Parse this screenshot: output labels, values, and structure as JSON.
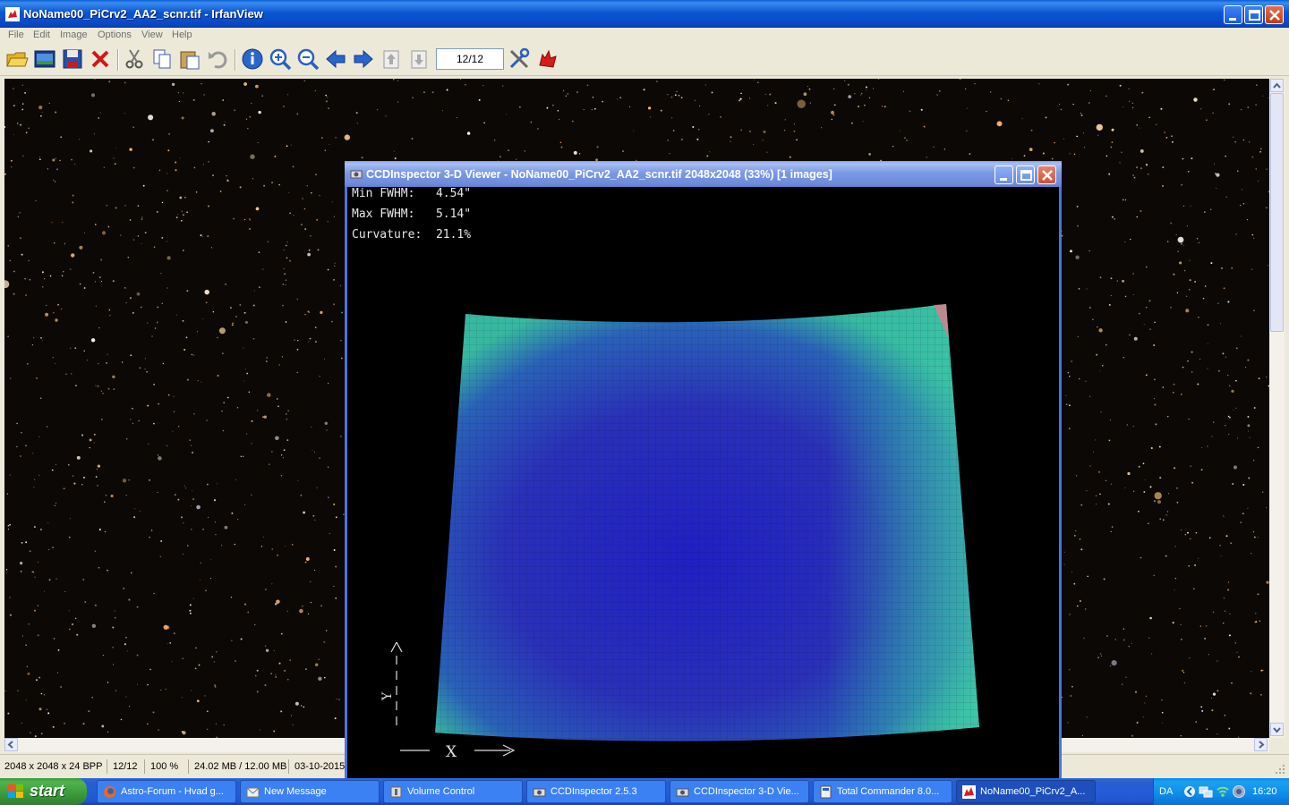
{
  "main_window": {
    "title": "NoName00_PiCrv2_AA2_scnr.tif - IrfanView",
    "menu": [
      "File",
      "Edit",
      "Image",
      "Options",
      "View",
      "Help"
    ],
    "page_counter": "12/12",
    "toolbar_icons": [
      "open-folder-icon",
      "thumbnails-icon",
      "save-icon",
      "delete-icon",
      "cut-icon",
      "copy-icon",
      "paste-icon",
      "undo-icon",
      "info-icon",
      "zoom-in-icon",
      "zoom-out-icon",
      "previous-arrow-icon",
      "next-arrow-icon",
      "first-page-icon",
      "last-page-icon",
      "settings-tools-icon",
      "irfanview-cat-icon"
    ]
  },
  "status_bar": {
    "dimensions": "2048 x 2048 x 24 BPP",
    "index": "12/12",
    "zoom": "100 %",
    "memory": "24.02 MB / 12.00 MB",
    "date": "03-10-2015"
  },
  "viewer": {
    "title": "CCDInspector 3-D Viewer - NoName00_PiCrv2_AA2_scnr.tif 2048x2048 (33%)  [1 images]",
    "stats": [
      {
        "label": "Min FWHM:",
        "value": "4.54\""
      },
      {
        "label": "Max FWHM:",
        "value": "5.14\""
      },
      {
        "label": "Curvature:",
        "value": "21.1%"
      }
    ],
    "axis_x_label": "X",
    "axis_y_label": "Y"
  },
  "taskbar": {
    "start_label": "start",
    "tasks": [
      {
        "label": "Astro-Forum - Hvad g...",
        "icon": "firefox-icon"
      },
      {
        "label": "New Message",
        "icon": "new-message-icon"
      },
      {
        "label": "Volume Control",
        "icon": "volume-control-icon"
      },
      {
        "label": "CCDInspector 2.5.3",
        "icon": "ccdinspector-icon"
      },
      {
        "label": "CCDInspector 3-D Vie...",
        "icon": "ccdinspector-icon"
      },
      {
        "label": "Total Commander 8.0...",
        "icon": "total-commander-icon"
      },
      {
        "label": "NoName00_PiCrv2_A...",
        "icon": "irfanview-icon"
      }
    ],
    "tray_language": "DA",
    "clock": "16:20"
  },
  "colors": {
    "titlebar_active": "#0b56d2",
    "titlebar_inactive": "#7b99e4",
    "taskbar": "#245dd8",
    "start_button": "#3a9a3a",
    "surface_center": "#2828c8",
    "surface_edge": "#30b8a0"
  }
}
